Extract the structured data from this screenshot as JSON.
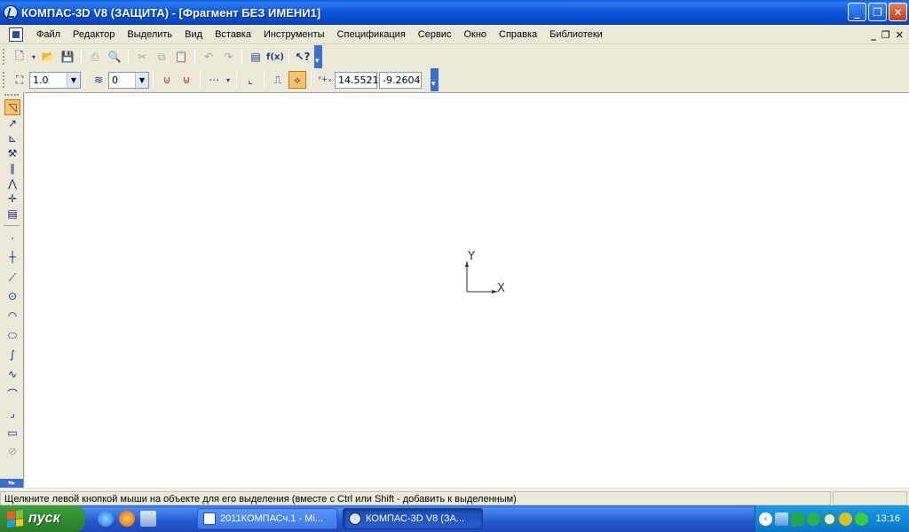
{
  "window": {
    "title": "КОМПАС-3D V8 (ЗАЩИТА) - [Фрагмент БЕЗ ИМЕНИ1]"
  },
  "menu": [
    "Файл",
    "Редактор",
    "Выделить",
    "Вид",
    "Вставка",
    "Инструменты",
    "Спецификация",
    "Сервис",
    "Окно",
    "Справка",
    "Библиотеки"
  ],
  "toolbar2": {
    "scale_value": "1.0",
    "layer_value": "0",
    "coord_x": "14.5521",
    "coord_y": "-9.2604"
  },
  "canvas": {
    "axis_y_label": "Y",
    "axis_x_label": "X"
  },
  "status": {
    "text": "Щелкните левой кнопкой мыши на объекте для его выделения (вместе с Ctrl или Shift - добавить к выделенным)"
  },
  "taskbar": {
    "start_label": "пуск",
    "tasks": [
      {
        "label": "2011КОМПАСч.1 - Mi..."
      },
      {
        "label": "КОМПАС-3D V8 (ЗА..."
      }
    ],
    "clock": "13:16"
  },
  "colors": {
    "titlebar": "#0a54d8",
    "taskbar": "#2457cf",
    "start": "#3c9e3c",
    "tray": "#0f86d8",
    "active_tool": "#ffc36b"
  }
}
